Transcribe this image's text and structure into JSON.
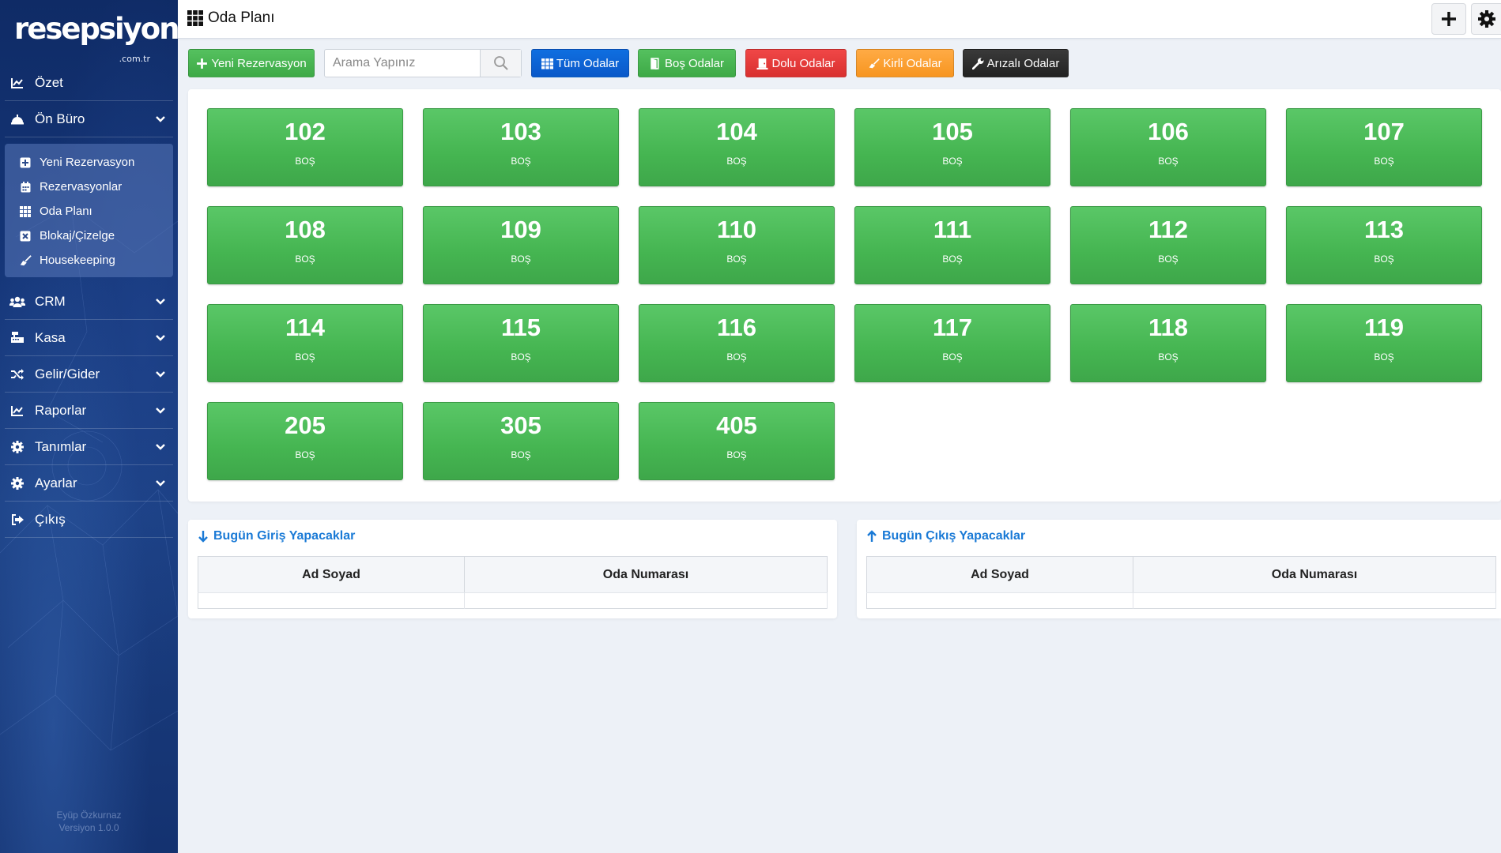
{
  "brand": {
    "name": "resepsiyon",
    "tld": ".com.tr"
  },
  "sidebar": {
    "items": [
      {
        "label": "Özet",
        "icon": "chart-line-icon"
      },
      {
        "label": "Ön Büro",
        "icon": "concierge-bell-icon",
        "expanded": true
      },
      {
        "label": "CRM",
        "icon": "users-icon"
      },
      {
        "label": "Kasa",
        "icon": "cash-register-icon"
      },
      {
        "label": "Gelir/Gider",
        "icon": "random-icon"
      },
      {
        "label": "Raporlar",
        "icon": "chart-area-icon"
      },
      {
        "label": "Tanımlar",
        "icon": "cog-icon"
      },
      {
        "label": "Ayarlar",
        "icon": "cog-icon"
      },
      {
        "label": "Çıkış",
        "icon": "sign-out-icon"
      }
    ],
    "submenu": [
      {
        "label": "Yeni Rezervasyon",
        "icon": "plus-square-icon"
      },
      {
        "label": "Rezervasyonlar",
        "icon": "calendar-icon"
      },
      {
        "label": "Oda Planı",
        "icon": "th-icon"
      },
      {
        "label": "Blokaj/Çizelge",
        "icon": "times-square-icon"
      },
      {
        "label": "Housekeeping",
        "icon": "broom-icon"
      }
    ],
    "footer": {
      "author": "Eyüp Özkurnaz",
      "version": "Versiyon 1.0.0"
    }
  },
  "header": {
    "title": "Oda Planı"
  },
  "toolbar": {
    "new_reservation": "Yeni Rezervasyon",
    "search_placeholder": "Arama Yapınız",
    "all_rooms": "Tüm Odalar",
    "empty_rooms": "Boş Odalar",
    "occupied_rooms": "Dolu Odalar",
    "dirty_rooms": "Kirli Odalar",
    "broken_rooms": "Arızalı Odalar"
  },
  "rooms": [
    {
      "number": "102",
      "status": "BOŞ"
    },
    {
      "number": "103",
      "status": "BOŞ"
    },
    {
      "number": "104",
      "status": "BOŞ"
    },
    {
      "number": "105",
      "status": "BOŞ"
    },
    {
      "number": "106",
      "status": "BOŞ"
    },
    {
      "number": "107",
      "status": "BOŞ"
    },
    {
      "number": "108",
      "status": "BOŞ"
    },
    {
      "number": "109",
      "status": "BOŞ"
    },
    {
      "number": "110",
      "status": "BOŞ"
    },
    {
      "number": "111",
      "status": "BOŞ"
    },
    {
      "number": "112",
      "status": "BOŞ"
    },
    {
      "number": "113",
      "status": "BOŞ"
    },
    {
      "number": "114",
      "status": "BOŞ"
    },
    {
      "number": "115",
      "status": "BOŞ"
    },
    {
      "number": "116",
      "status": "BOŞ"
    },
    {
      "number": "117",
      "status": "BOŞ"
    },
    {
      "number": "118",
      "status": "BOŞ"
    },
    {
      "number": "119",
      "status": "BOŞ"
    },
    {
      "number": "205",
      "status": "BOŞ"
    },
    {
      "number": "305",
      "status": "BOŞ"
    },
    {
      "number": "405",
      "status": "BOŞ"
    }
  ],
  "checkin_panel": {
    "title": "Bugün Giriş Yapacaklar",
    "columns": [
      "Ad Soyad",
      "Oda Numarası"
    ]
  },
  "checkout_panel": {
    "title": "Bugün Çıkış Yapacaklar",
    "columns": [
      "Ad Soyad",
      "Oda Numarası"
    ]
  },
  "colors": {
    "sidebar_bg": "#16377a",
    "room_empty": "#45b551",
    "accent_blue": "#1a7ad6",
    "btn_red": "#d9302f",
    "btn_orange": "#f79520",
    "btn_dark": "#222222"
  }
}
